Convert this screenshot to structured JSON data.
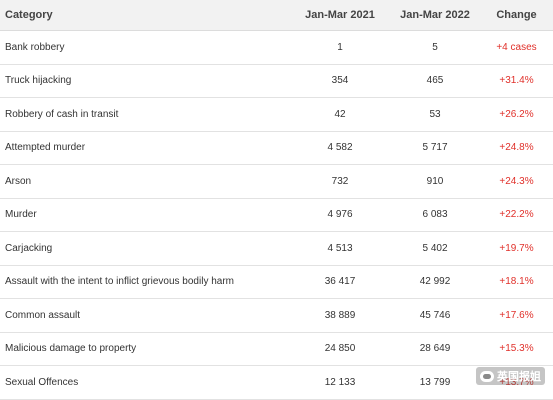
{
  "headers": {
    "category": "Category",
    "jan_mar_2021": "Jan-Mar 2021",
    "jan_mar_2022": "Jan-Mar 2022",
    "change": "Change"
  },
  "rows": [
    {
      "category": "Bank robbery",
      "y2021": "1",
      "y2022": "5",
      "change": "+4 cases"
    },
    {
      "category": "Truck hijacking",
      "y2021": "354",
      "y2022": "465",
      "change": "+31.4%"
    },
    {
      "category": "Robbery of cash in transit",
      "y2021": "42",
      "y2022": "53",
      "change": "+26.2%"
    },
    {
      "category": "Attempted murder",
      "y2021": "4 582",
      "y2022": "5 717",
      "change": "+24.8%"
    },
    {
      "category": "Arson",
      "y2021": "732",
      "y2022": "910",
      "change": "+24.3%"
    },
    {
      "category": "Murder",
      "y2021": "4 976",
      "y2022": "6 083",
      "change": "+22.2%"
    },
    {
      "category": "Carjacking",
      "y2021": "4 513",
      "y2022": "5 402",
      "change": "+19.7%"
    },
    {
      "category": "Assault with the intent to inflict grievous bodily harm",
      "y2021": "36 417",
      "y2022": "42 992",
      "change": "+18.1%"
    },
    {
      "category": "Common assault",
      "y2021": "38 889",
      "y2022": "45 746",
      "change": "+17.6%"
    },
    {
      "category": "Malicious damage to property",
      "y2021": "24 850",
      "y2022": "28 649",
      "change": "+15.3%"
    },
    {
      "category": "Sexual Offences",
      "y2021": "12 133",
      "y2022": "13 799",
      "change": "+13.7%"
    }
  ],
  "watermark": {
    "text": "英国报姐",
    "icon": "wechat-icon"
  },
  "colors": {
    "change_text": "#e0302a",
    "header_bg": "#f2f2f2"
  }
}
